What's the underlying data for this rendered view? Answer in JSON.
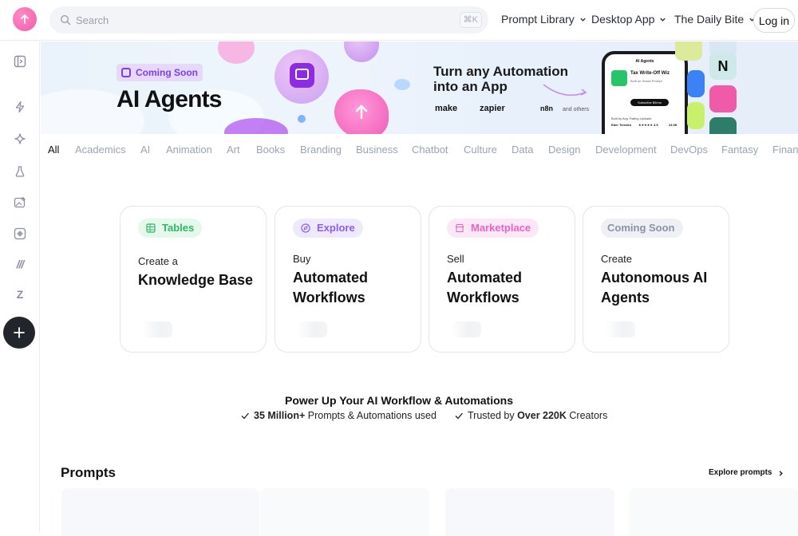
{
  "header": {
    "search_placeholder": "Search",
    "search_shortcut": "⌘K",
    "nav": [
      "Prompt Library",
      "Desktop App",
      "The Daily Bite"
    ],
    "login_label": "Log in"
  },
  "sidebar": {
    "icons": [
      "sidebar-toggle-icon",
      "lightning-icon",
      "sparkle-icon",
      "flask-icon",
      "image-plus-icon",
      "puzzle-icon",
      "make-icon",
      "zapier-icon",
      "plus-icon"
    ]
  },
  "banner": {
    "badge": "Coming Soon",
    "title": "AI Agents",
    "headline": "Turn any Automation into an App",
    "brands": [
      "make",
      "zapier",
      "n8n",
      "and others"
    ],
    "phone": {
      "header": "AI Agents",
      "app_name": "Tax Write-Off Wiz",
      "app_sub": "Built on Snack Prompt",
      "button": "Subscribe $9/mo",
      "row_labels": "Built by    Avg. Rating    Uploads",
      "author": "Eder Teixeira",
      "rating": "★★★★★ 4.9",
      "count": "23.3K"
    }
  },
  "categories": [
    "All",
    "Academics",
    "AI",
    "Animation",
    "Art",
    "Books",
    "Branding",
    "Business",
    "Chatbot",
    "Culture",
    "Data",
    "Design",
    "Development",
    "DevOps",
    "Fantasy",
    "Finance"
  ],
  "cards": [
    {
      "pill": "Tables",
      "small": "Create a",
      "big": "Knowledge Base",
      "pill_color": "#2fb866",
      "pill_bg": "#e4f8ec"
    },
    {
      "pill": "Explore",
      "small": "Buy",
      "big": "Automated Workflows",
      "pill_color": "#8b5cf6",
      "pill_bg": "#efe9fd"
    },
    {
      "pill": "Marketplace",
      "small": "Sell",
      "big": "Automated Workflows",
      "pill_color": "#ec63c7",
      "pill_bg": "#fce7f6"
    },
    {
      "pill": "Coming Soon",
      "small": "Create",
      "big": "Autonomous AI Agents",
      "pill_color": "#8a93a6",
      "pill_bg": "#eef0f4"
    }
  ],
  "power": {
    "title": "Power Up Your AI Workflow & Automations",
    "stat1_bold": "35 Million+",
    "stat1_rest": " Prompts & Automations used",
    "stat2_pre": "Trusted by ",
    "stat2_bold": "Over 220K",
    "stat2_rest": " Creators"
  },
  "prompts": {
    "title": "Prompts",
    "explore": "Explore prompts"
  }
}
